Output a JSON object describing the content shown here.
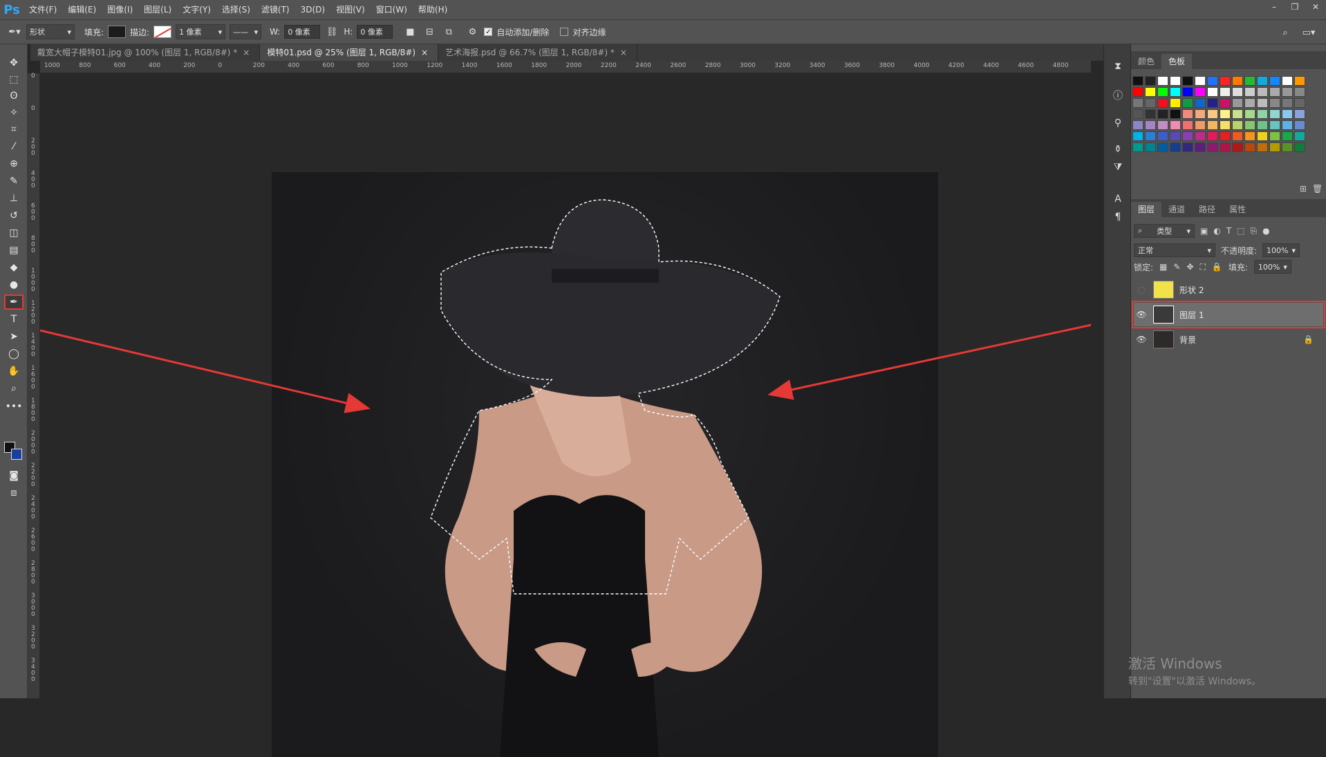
{
  "app": {
    "logo": "Ps"
  },
  "menu": [
    "文件(F)",
    "编辑(E)",
    "图像(I)",
    "图层(L)",
    "文字(Y)",
    "选择(S)",
    "滤镜(T)",
    "3D(D)",
    "视图(V)",
    "窗口(W)",
    "帮助(H)"
  ],
  "window_controls": [
    "–",
    "❐",
    "✕"
  ],
  "options": {
    "mode": "形状",
    "fill_label": "填充:",
    "stroke_label": "描边:",
    "stroke_width": "1 像素",
    "w_label": "W:",
    "w_value": "0 像素",
    "h_label": "H:",
    "h_value": "0 像素",
    "auto_add_delete": "自动添加/删除",
    "auto_add_delete_checked": true,
    "align_edges": "对齐边缘",
    "align_edges_checked": false
  },
  "tabs": [
    {
      "label": "戴宽大帽子模特01.jpg @ 100% (图层 1, RGB/8#) *",
      "close": "×",
      "active": false
    },
    {
      "label": "模特01.psd @ 25% (图层 1, RGB/8#)",
      "close": "×",
      "active": true
    },
    {
      "label": "艺术海报.psd @ 66.7% (图层 1, RGB/8#) *",
      "close": "×",
      "active": false
    }
  ],
  "ruler_top_labels": [
    "1000",
    "800",
    "600",
    "400",
    "200",
    "0",
    "200",
    "400",
    "600",
    "800",
    "1000",
    "1200",
    "1400",
    "1600",
    "1800",
    "2000",
    "2200",
    "2400",
    "2600",
    "2800",
    "3000",
    "3200",
    "3400",
    "3600",
    "3800",
    "4000",
    "4200",
    "4400",
    "4600",
    "4800"
  ],
  "ruler_left_labels": [
    "0",
    "0",
    "2 0 0",
    "4 0 0",
    "6 0 0",
    "8 0 0",
    "1 0 0 0",
    "1 2 0 0",
    "1 4 0 0",
    "1 6 0 0",
    "1 8 0 0",
    "2 0 0 0",
    "2 2 0 0",
    "2 4 0 0",
    "2 6 0 0",
    "2 8 0 0",
    "3 0 0 0",
    "3 2 0 0",
    "3 4 0 0"
  ],
  "swatches_panel": {
    "tabs": [
      "颜色",
      "色板"
    ],
    "active_tab": "色板"
  },
  "swatch_colors": [
    "#111111",
    "#222222",
    "#ffffff",
    "#ffffff",
    "#111111",
    "#ffffff",
    "#1e73ff",
    "#ff2222",
    "#ff7a00",
    "#22bb33",
    "#11aadd",
    "#1188ff",
    "#ffffff",
    "#ff9900",
    "#ff0000",
    "#ffff00",
    "#00ff00",
    "#00ffff",
    "#0000ff",
    "#ff00ff",
    "#ffffff",
    "#eeeeee",
    "#dddddd",
    "#cccccc",
    "#bbbbbb",
    "#aaaaaa",
    "#999999",
    "#888888",
    "#777777",
    "#666666",
    "#ee1122",
    "#ffee00",
    "#119944",
    "#1166cc",
    "#222288",
    "#cc1166",
    "#999999",
    "#aaaaaa",
    "#bbbbbb",
    "#888888",
    "#777777",
    "#666666",
    "#555555",
    "#333333",
    "#222222",
    "#111111",
    "#f08a7a",
    "#f4a97c",
    "#f8c882",
    "#fbf08a",
    "#c8e08c",
    "#a6d98d",
    "#8fd3a6",
    "#8fd6d0",
    "#89c8ee",
    "#8aa3dc",
    "#8c85c8",
    "#a286c4",
    "#c48bc4",
    "#f08bb4",
    "#f07070",
    "#f29a66",
    "#f5b45e",
    "#f6df64",
    "#b6d46a",
    "#86c86e",
    "#6cc488",
    "#66c6bf",
    "#5fb2e6",
    "#6a8bd2",
    "#00b3e6",
    "#2a80d8",
    "#3a5fc8",
    "#5a4ab8",
    "#8a40b0",
    "#c02a8a",
    "#e8195a",
    "#e81e25",
    "#f05a22",
    "#f7931e",
    "#f2d11b",
    "#7dc242",
    "#18a84a",
    "#14a99c",
    "#009a8c",
    "#00848e",
    "#005e9e",
    "#173e8c",
    "#32297a",
    "#5b1f7a",
    "#8c1a6e",
    "#b0154a",
    "#b01818",
    "#b8470d",
    "#c06d0a",
    "#b59b00",
    "#5a9128",
    "#127a3a"
  ],
  "layers_panel": {
    "tabs": [
      "图层",
      "通道",
      "路径",
      "属性"
    ],
    "active_tab": "图层",
    "filter": "类型",
    "blend_mode": "正常",
    "opacity_label": "不透明度:",
    "opacity": "100%",
    "lock_label": "锁定:",
    "fill_label": "填充:",
    "fill": "100%",
    "layers": [
      {
        "name": "形状 2",
        "visible": false,
        "selected": false,
        "locked": false
      },
      {
        "name": "图层 1",
        "visible": true,
        "selected": true,
        "locked": false
      },
      {
        "name": "背景",
        "visible": true,
        "selected": false,
        "locked": true
      }
    ]
  },
  "watermark": {
    "line1": "激活 Windows",
    "line2": "转到\"设置\"以激活 Windows。"
  },
  "colors": {
    "highlight_red": "#e53935",
    "ps_blue": "#31a8ff"
  }
}
